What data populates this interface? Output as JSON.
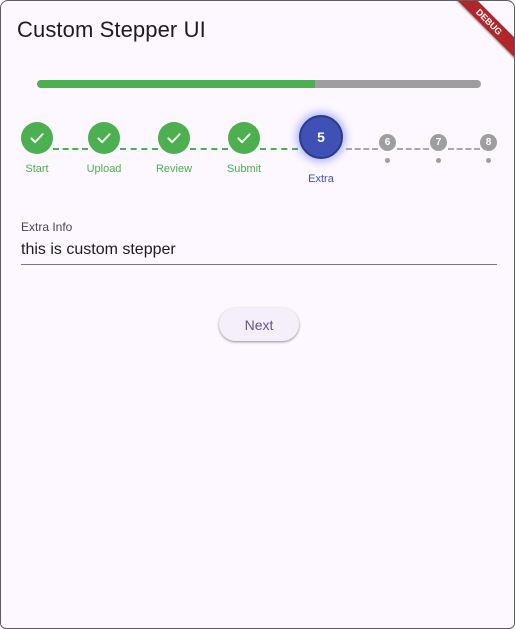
{
  "app": {
    "title": "Custom Stepper UI",
    "debug_banner": "DEBUG"
  },
  "progress": {
    "fraction": 0.625
  },
  "colors": {
    "completed": "#4caf50",
    "active": "#3f51b5",
    "pending": "#9e9e9e"
  },
  "steps": [
    {
      "label": "Start",
      "state": "completed",
      "icon": "check-icon"
    },
    {
      "label": "Upload",
      "state": "completed",
      "icon": "check-icon"
    },
    {
      "label": "Review",
      "state": "completed",
      "icon": "check-icon"
    },
    {
      "label": "Submit",
      "state": "completed",
      "icon": "check-icon"
    },
    {
      "number": "5",
      "label": "Extra",
      "state": "active"
    },
    {
      "number": "6",
      "state": "pending"
    },
    {
      "number": "7",
      "state": "pending"
    },
    {
      "number": "8",
      "state": "pending"
    }
  ],
  "form": {
    "label": "Extra Info",
    "value": "this is custom stepper"
  },
  "actions": {
    "next_label": "Next"
  }
}
